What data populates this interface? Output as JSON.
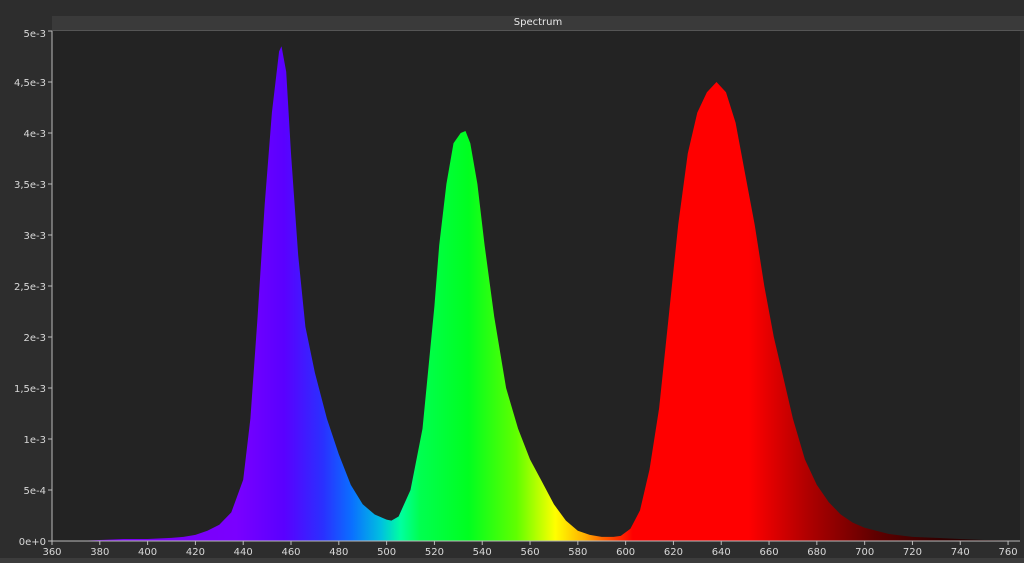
{
  "window": {
    "title": "Spectrum"
  },
  "chart_data": {
    "type": "area",
    "title": "Spectrum",
    "xlabel": "",
    "ylabel": "",
    "xlim": [
      360,
      765
    ],
    "ylim": [
      0,
      0.005
    ],
    "grid": false,
    "x_ticks": [
      360,
      380,
      400,
      420,
      440,
      460,
      480,
      500,
      520,
      540,
      560,
      580,
      600,
      620,
      640,
      660,
      680,
      700,
      720,
      740,
      760
    ],
    "x_tick_labels": [
      "360",
      "380",
      "400",
      "420",
      "440",
      "460",
      "480",
      "500",
      "520",
      "540",
      "560",
      "580",
      "600",
      "620",
      "640",
      "660",
      "680",
      "700",
      "720",
      "740",
      "760"
    ],
    "y_ticks": [
      0,
      0.0005,
      0.001,
      0.0015,
      0.002,
      0.0025,
      0.003,
      0.0035,
      0.004,
      0.0045,
      0.005
    ],
    "y_tick_labels": [
      "0e+0",
      "5e-4",
      "1e-3",
      "1,5e-3",
      "2e-3",
      "2,5e-3",
      "3e-3",
      "3,5e-3",
      "4e-3",
      "4,5e-3",
      "5e-3"
    ],
    "x": [
      360,
      370,
      380,
      390,
      400,
      410,
      415,
      420,
      425,
      430,
      435,
      440,
      443,
      446,
      449,
      452,
      455,
      456,
      458,
      460,
      463,
      466,
      470,
      475,
      480,
      485,
      490,
      495,
      500,
      502,
      505,
      510,
      515,
      520,
      522,
      525,
      528,
      531,
      533,
      535,
      538,
      541,
      545,
      550,
      555,
      560,
      565,
      570,
      575,
      580,
      585,
      590,
      595,
      598,
      602,
      606,
      610,
      614,
      618,
      622,
      626,
      630,
      634,
      638,
      642,
      646,
      650,
      654,
      658,
      662,
      666,
      670,
      675,
      680,
      685,
      690,
      695,
      700,
      710,
      720,
      730,
      740,
      750,
      765
    ],
    "y": [
      0,
      0,
      1e-05,
      2e-05,
      2e-05,
      3e-05,
      4e-05,
      6e-05,
      0.0001,
      0.00016,
      0.00028,
      0.0006,
      0.0012,
      0.0022,
      0.0033,
      0.0042,
      0.0048,
      0.00485,
      0.0046,
      0.0038,
      0.0028,
      0.0021,
      0.00165,
      0.0012,
      0.00085,
      0.00055,
      0.00036,
      0.00026,
      0.00021,
      0.0002,
      0.00024,
      0.0005,
      0.0011,
      0.0023,
      0.0029,
      0.0035,
      0.0039,
      0.004,
      0.00402,
      0.0039,
      0.0035,
      0.0029,
      0.0022,
      0.0015,
      0.0011,
      0.0008,
      0.00058,
      0.00036,
      0.0002,
      0.0001,
      6e-05,
      4e-05,
      4e-05,
      5e-05,
      0.00012,
      0.0003,
      0.0007,
      0.0013,
      0.0022,
      0.0031,
      0.0038,
      0.0042,
      0.0044,
      0.0045,
      0.0044,
      0.0041,
      0.0036,
      0.0031,
      0.0025,
      0.002,
      0.0016,
      0.0012,
      0.0008,
      0.00055,
      0.00038,
      0.00026,
      0.00018,
      0.00013,
      7e-05,
      4e-05,
      3e-05,
      2e-05,
      1e-05,
      5e-06
    ],
    "series_color": "spectral-gradient"
  }
}
